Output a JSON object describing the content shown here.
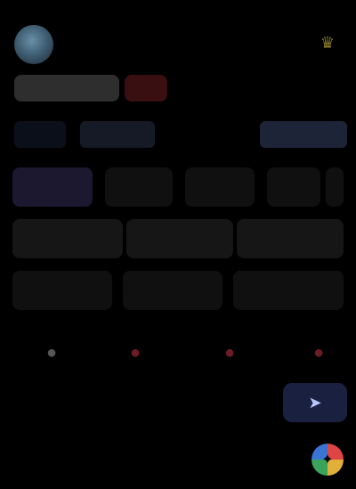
{
  "header": {
    "title": "",
    "subtitle": "",
    "crown_glyph": "♛",
    "icons": {
      "avatar": "avatar",
      "crown": "crown-icon"
    }
  },
  "actions": {
    "primary_label": "",
    "badge_label": ""
  },
  "tabs": {
    "tab_1": "",
    "tab_2": "",
    "tab_3": ""
  },
  "grid": {
    "row_1": [
      "",
      "",
      "",
      "",
      ""
    ],
    "row_2": [
      "",
      "",
      ""
    ],
    "row_3": [
      "",
      "",
      ""
    ]
  },
  "symbols": {
    "glyphs": [
      "●",
      "●",
      "●",
      "●"
    ]
  },
  "row_5": {
    "items": [
      "",
      "",
      ""
    ],
    "send_glyph": "➤"
  },
  "footer": {
    "text": "",
    "fab_glyph": "✦"
  },
  "colors": {
    "background": "#000000",
    "accent_blue": "#1d2438",
    "accent_red": "#3a0f12"
  }
}
